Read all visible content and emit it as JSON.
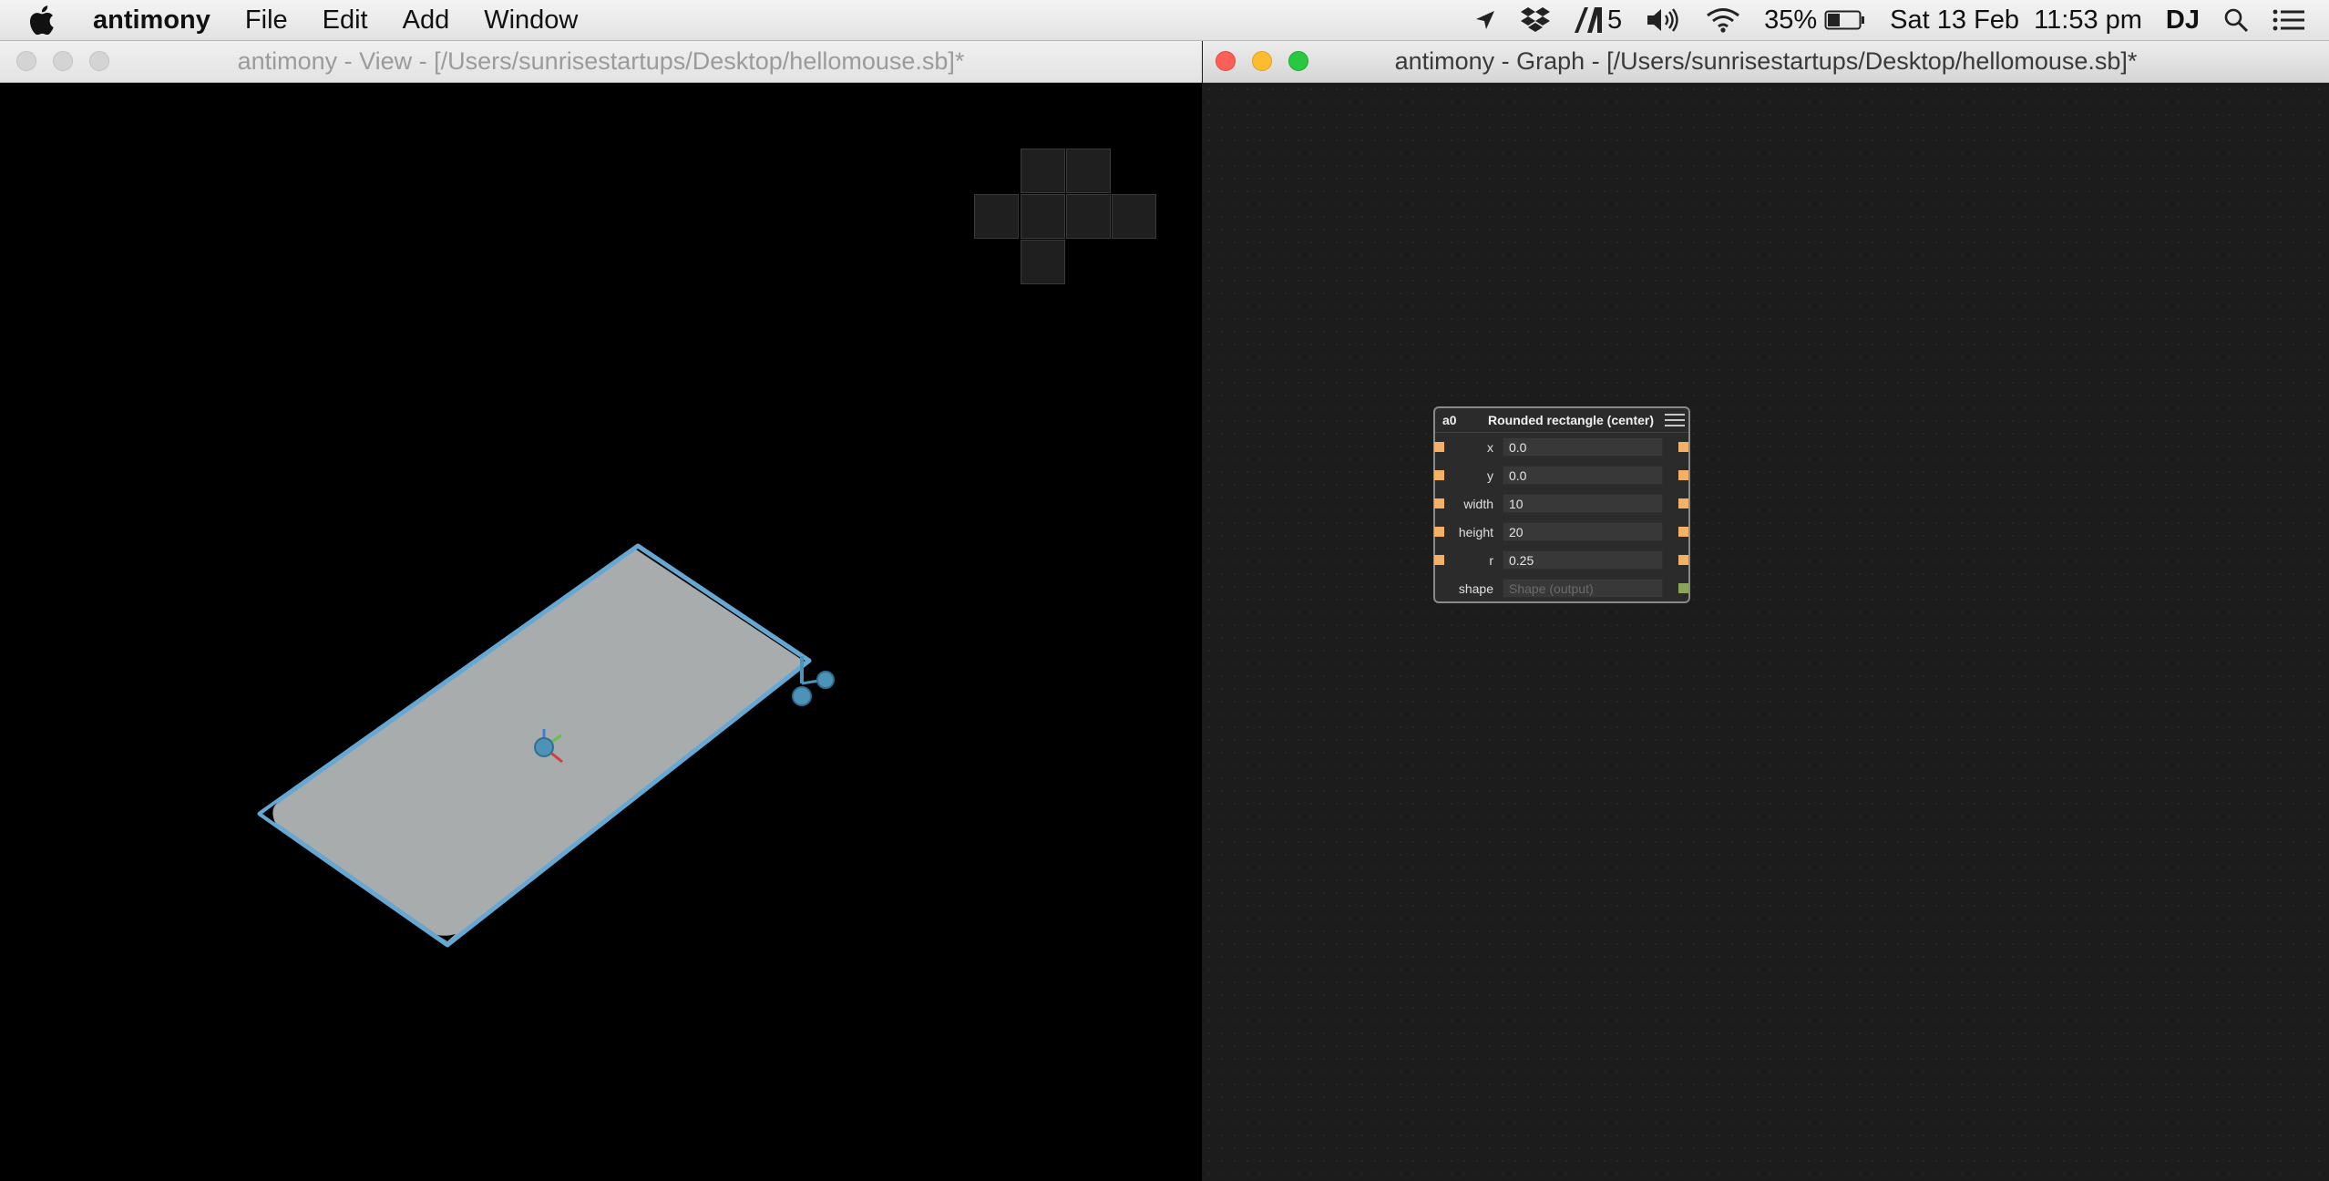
{
  "menubar": {
    "app_name": "antimony",
    "items": [
      "File",
      "Edit",
      "Add",
      "Window"
    ],
    "status": {
      "adobe_count": "5",
      "battery": "35%",
      "datetime": "Sat 13 Feb  11:53 pm",
      "user": "DJ"
    }
  },
  "view_window": {
    "title": "antimony - View - [/Users/sunrisestartups/Desktop/hellomouse.sb]*"
  },
  "graph_window": {
    "title": "antimony - Graph - [/Users/sunrisestartups/Desktop/hellomouse.sb]*"
  },
  "node": {
    "name": "a0",
    "title": "Rounded rectangle (center)",
    "rows": [
      {
        "label": "x",
        "value": "0.0"
      },
      {
        "label": "y",
        "value": "0.0"
      },
      {
        "label": "width",
        "value": "10"
      },
      {
        "label": "height",
        "value": "20"
      },
      {
        "label": "r",
        "value": "0.25"
      },
      {
        "label": "shape",
        "value": "Shape (output)"
      }
    ]
  },
  "colors": {
    "shape_fill": "#a8acad",
    "shape_outline": "#66a8d4",
    "handle": "#4d93b8",
    "port_input": "#f3b067",
    "port_output_shape": "#8aa55a"
  }
}
